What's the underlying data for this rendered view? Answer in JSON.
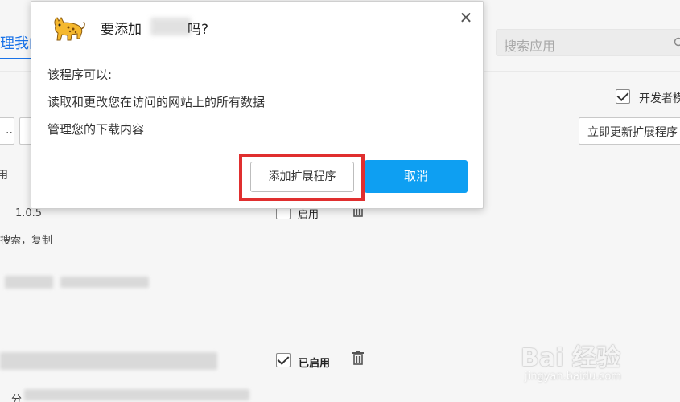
{
  "background": {
    "title": "理我的",
    "search": {
      "placeholder": "搜索应用"
    },
    "developer_mode": {
      "label": "开发者模",
      "checked": true
    },
    "buttons": {
      "small_1": "...",
      "small_2": "",
      "update_label": "立即更新扩展程序"
    },
    "partial_text_1": "用",
    "extensions": [
      {
        "version": "1.0.5",
        "description": "搜索，复制",
        "enabled": false,
        "enable_label": "启用"
      },
      {
        "enabled": true,
        "enable_label": "已启用"
      }
    ],
    "partial_text_2": "分"
  },
  "dialog": {
    "title_prefix": "要添加",
    "title_suffix": "吗?",
    "close_symbol": "✕",
    "permissions_heading": "该程序可以:",
    "permissions": [
      "读取和更改您在访问的网站上的所有数据",
      "管理您的下载内容"
    ],
    "add_button_label": "添加扩展程序",
    "cancel_button_label": "取消"
  },
  "watermark": {
    "main": "Bai 经验",
    "sub": "jingyan.baidu.com"
  },
  "colors": {
    "accent": "#1a73e8",
    "primary_button": "#0e9ff2",
    "highlight": "#e02f2f"
  }
}
